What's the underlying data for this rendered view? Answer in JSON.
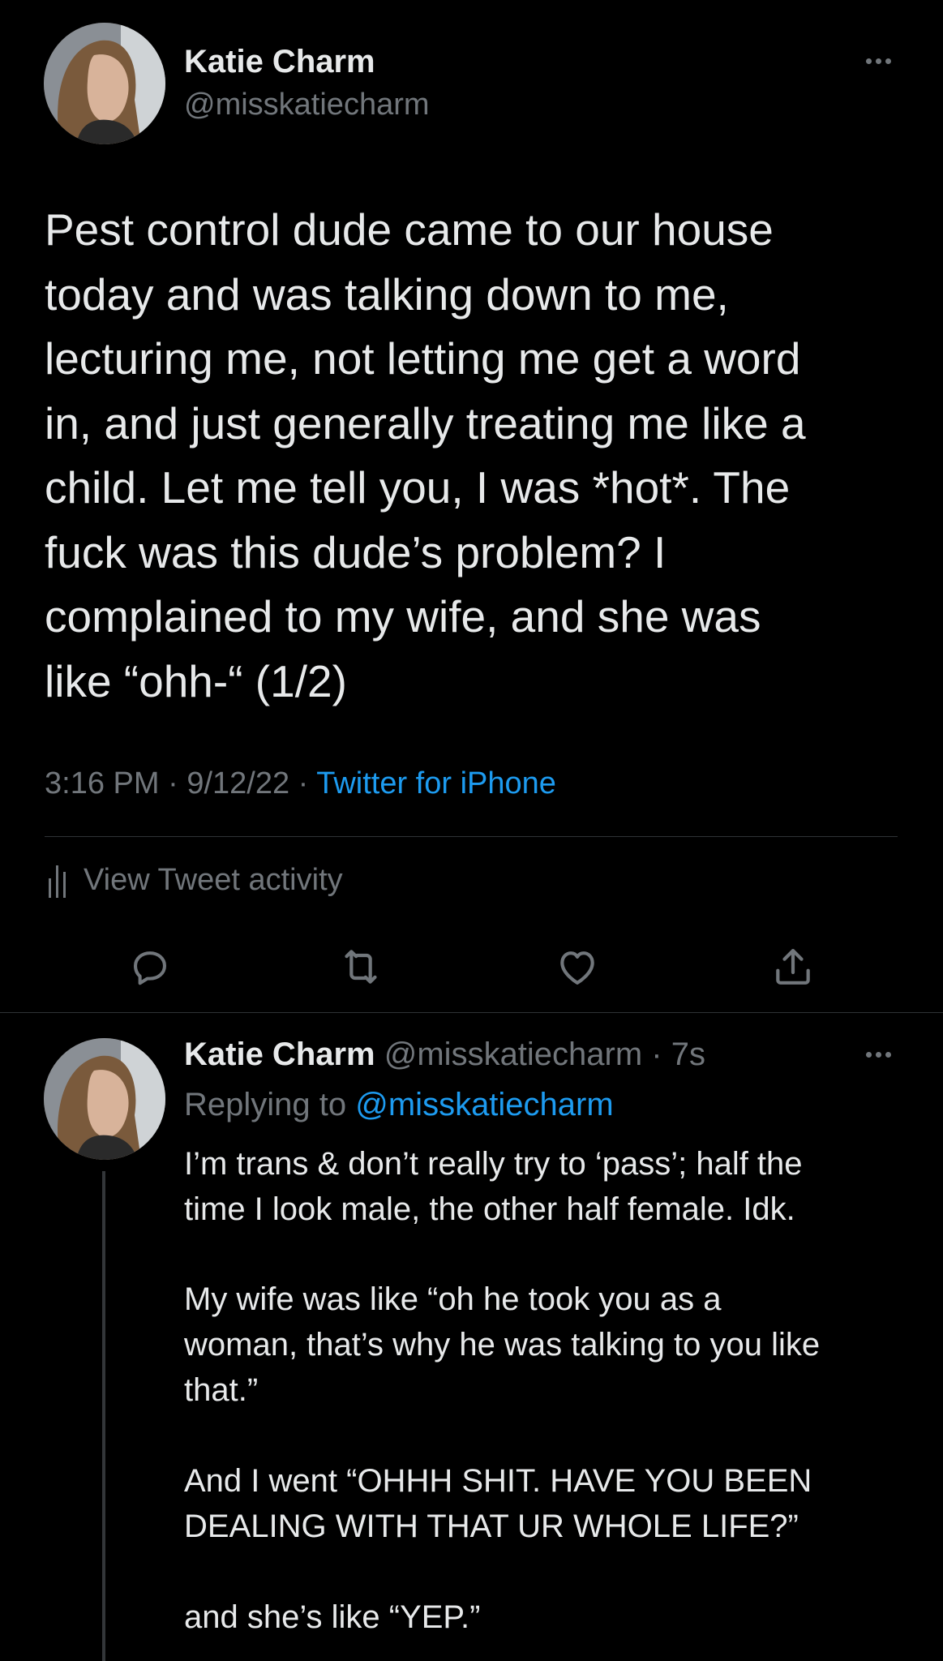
{
  "tweet": {
    "author_name": "Katie Charm",
    "author_handle": "@misskatiecharm",
    "text_lines": [
      "Pest control dude came to our house",
      "today and was talking down to me,",
      "lecturing me, not letting me get a word",
      "in, and just generally treating me like a",
      "child. Let me tell you, I was *hot*. The",
      "fuck was this dude’s problem? I",
      "complained to my wife, and she was",
      "like “ohh-“ (1/2)"
    ],
    "time": "3:16 PM",
    "date": "9/12/22",
    "source": "Twitter for iPhone",
    "view_activity_label": "View Tweet activity"
  },
  "reply": {
    "author_name": "Katie Charm",
    "author_handle": "@misskatiecharm",
    "age": "7s",
    "replying_label": "Replying to",
    "replying_to": "@misskatiecharm",
    "paragraphs": [
      [
        "I’m trans & don’t really try to ‘pass’; half the",
        "time I look male, the other half female. Idk."
      ],
      [
        "My wife was like “oh he took you as a",
        "woman, that’s why he was talking to you like",
        "that.”"
      ],
      [
        "And I went “OHHH SHIT. HAVE YOU BEEN",
        "DEALING WITH THAT UR WHOLE LIFE?”"
      ],
      [
        "and she’s like “YEP.”"
      ]
    ]
  },
  "separators": {
    "meta": " · "
  },
  "icons": {
    "more": "more-horizontal-icon",
    "reply": "reply-icon",
    "retweet": "retweet-icon",
    "like": "heart-icon",
    "share": "share-icon",
    "activity": "bar-chart-icon"
  },
  "colors": {
    "background": "#000000",
    "text": "#e7e9ea",
    "secondary": "#71767b",
    "link": "#1d9bf0",
    "divider": "#2f3336"
  }
}
